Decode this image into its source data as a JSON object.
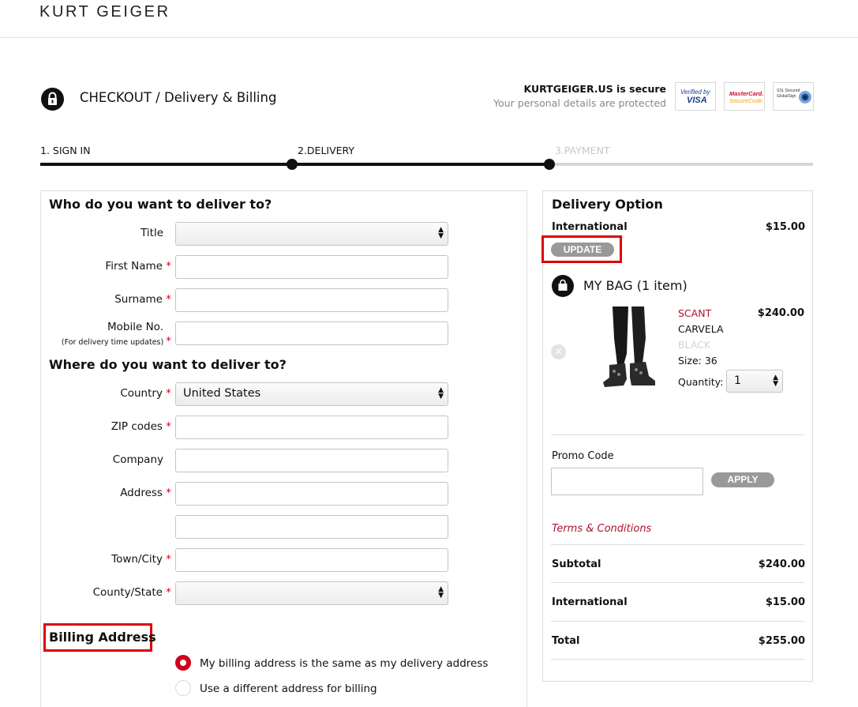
{
  "header": {
    "brand": "KURT GEIGER",
    "page_title": "CHECKOUT / Delivery & Billing",
    "secure_title": "KURTGEIGER.US is secure",
    "secure_sub": "Your personal details are protected",
    "badges": {
      "visa_line1": "Verified by",
      "visa_line2": "VISA",
      "mc_line1": "MasterCard.",
      "mc_line2": "SecureCode.",
      "gs_line1": "SSL Secured",
      "gs_line2": "GlobalSign"
    }
  },
  "progress": {
    "steps": [
      {
        "label": "1. SIGN IN",
        "state": "complete"
      },
      {
        "label": "2.DELIVERY",
        "state": "current"
      },
      {
        "label": "3.PAYMENT",
        "state": "upcoming"
      }
    ]
  },
  "delivery_form": {
    "who_title": "Who do you want to deliver to?",
    "where_title": "Where do you want to deliver to?",
    "required_mark": "*",
    "fields": {
      "title": {
        "label": "Title",
        "value": ""
      },
      "first_name": {
        "label": "First Name",
        "value": ""
      },
      "surname": {
        "label": "Surname",
        "value": ""
      },
      "mobile": {
        "label": "Mobile No.",
        "note": "(For delivery time updates)",
        "value": ""
      },
      "country": {
        "label": "Country",
        "value": "United States"
      },
      "zip": {
        "label": "ZIP codes",
        "value": ""
      },
      "company": {
        "label": "Company",
        "value": ""
      },
      "address": {
        "label": "Address",
        "value": ""
      },
      "address2": {
        "value": ""
      },
      "town": {
        "label": "Town/City",
        "value": ""
      },
      "county": {
        "label": "County/State",
        "value": ""
      }
    }
  },
  "billing": {
    "title": "Billing Address",
    "options": [
      {
        "label": "My billing address is the same as my delivery address",
        "selected": true
      },
      {
        "label": "Use a different address for billing",
        "selected": false
      }
    ]
  },
  "summary": {
    "delivery_option_title": "Delivery Option",
    "delivery_method": "International",
    "delivery_price": "$15.00",
    "update_label": "UPDATE",
    "bag_title": "MY BAG (1 item)",
    "item": {
      "name": "SCANT",
      "brand": "CARVELA",
      "color": "BLACK",
      "size": "Size: 36",
      "quantity_label": "Quantity:",
      "quantity": "1",
      "price": "$240.00"
    },
    "promo_label": "Promo Code",
    "promo_value": "",
    "apply_label": "APPLY",
    "terms_label": "Terms & Conditions",
    "subtotal_label": "Subtotal",
    "subtotal_value": "$240.00",
    "shipping_label": "International",
    "shipping_value": "$15.00",
    "total_label": "Total",
    "total_value": "$255.00"
  },
  "colors": {
    "accent_red": "#d0021b",
    "highlight_box": "#e00000",
    "link_red": "#b0122f",
    "button_gray": "#999999"
  }
}
